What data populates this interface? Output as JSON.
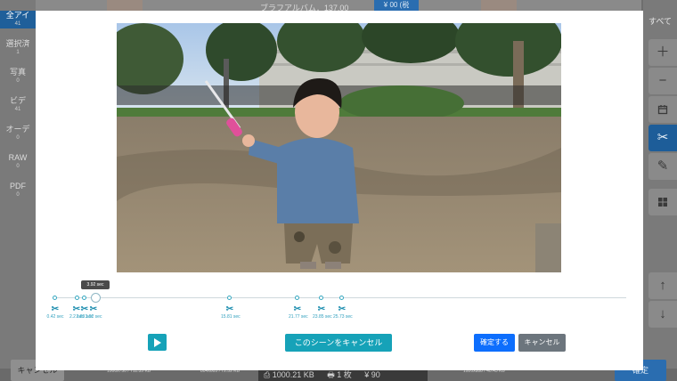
{
  "sidebar": {
    "items": [
      {
        "label": "全アイ",
        "count": "41",
        "active": true
      },
      {
        "label": "選択済",
        "count": "1",
        "active": false
      },
      {
        "label": "写真",
        "count": "0",
        "active": false
      },
      {
        "label": "ビデ",
        "count": "41",
        "active": false
      },
      {
        "label": "オーデ",
        "count": "0",
        "active": false
      },
      {
        "label": "RAW",
        "count": "0",
        "active": false
      },
      {
        "label": "PDF",
        "count": "0",
        "active": false
      }
    ]
  },
  "background": {
    "top_text": "ブラフアルバム．137.00",
    "top_button": "¥ 00 (税",
    "all_label": "すべて",
    "cancel_label": "キャンセル",
    "status": {
      "size": "1000.21 KB",
      "pages": "1 枚",
      "price": "¥ 90"
    },
    "thumb_labels": [
      "1000x750 / 711.35 KB",
      "804x605 / 72.52 KB",
      "1920x888 / 40.45 KB"
    ],
    "apply_label": "確定"
  },
  "right_toolbar": {
    "icons": [
      "plus-icon",
      "minus-icon",
      "calendar-icon",
      "scissors-icon",
      "edit-icon",
      "grid-icon",
      "arrow-up-icon",
      "arrow-down-icon"
    ]
  },
  "modal": {
    "timeline": {
      "current_time": "3.92 sec",
      "cut_points": [
        "0.42 sec",
        "2.2 sec",
        "2.89 sec",
        "3.92 sec",
        "15.81 sec",
        "21.77 sec",
        "23.85 sec",
        "25.73 sec"
      ]
    },
    "cancel_scene_label": "このシーンをキャンセル",
    "confirm_label": "確定する",
    "cancel_label": "キャンセル",
    "accent_color": "#16a2b8",
    "primary_color": "#0d6efd"
  }
}
